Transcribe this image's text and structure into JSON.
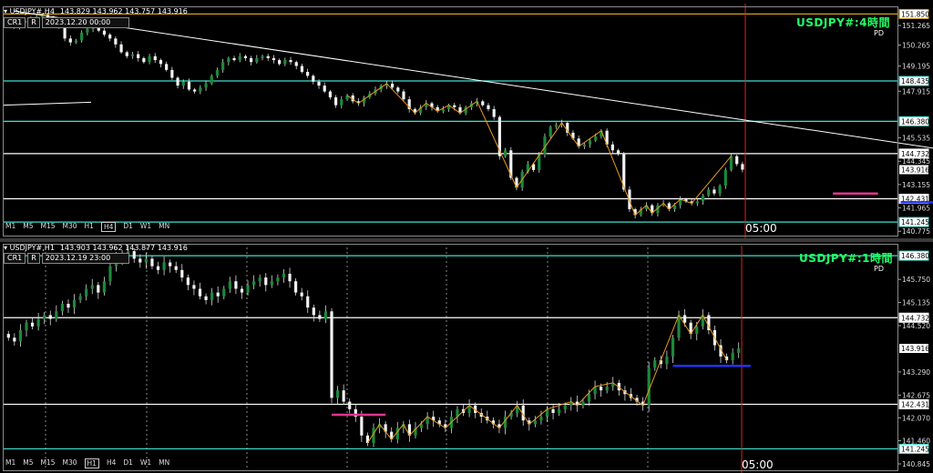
{
  "charts": [
    {
      "header": {
        "symbol": "USDJPY#,H4",
        "ohlc": "143.829 143.962 143.757 143.916"
      },
      "cr_label": "CR1",
      "r_label": "R",
      "cursor_date": "2023.12.20 00:00",
      "title": "USDJPY#:4時間",
      "pd": "PD",
      "timeframes": [
        "M1",
        "M5",
        "M15",
        "M30",
        "H1",
        "H4",
        "D1",
        "W1",
        "MN"
      ],
      "selected_timeframe": "H4",
      "time_label": "05:00"
    },
    {
      "header": {
        "symbol": "USDJPY#,H1",
        "ohlc": "143.903 143.962 143.877 143.916"
      },
      "cr_label": "CR1",
      "r_label": "R",
      "cursor_date": "2023.12.19 23:00",
      "title": "USDJPY#:1時間",
      "pd": "PD",
      "timeframes": [
        "M1",
        "M5",
        "M15",
        "M30",
        "H1",
        "H4",
        "D1",
        "W1",
        "MN"
      ],
      "selected_timeframe": "H1",
      "time_label": "05:00"
    }
  ],
  "chart_data": [
    {
      "type": "candlestick",
      "symbol": "USDJPY#",
      "timeframe": "H4",
      "y_ticks": [
        151.85,
        151.265,
        150.265,
        149.195,
        148.435,
        147.915,
        146.38,
        145.535,
        144.732,
        144.345,
        143.916,
        143.155,
        142.431,
        141.965,
        141.245,
        140.775
      ],
      "ylim": [
        140.6,
        152.1
      ],
      "levels": [
        {
          "price": 151.85,
          "label": "151.850",
          "color": "#d4a017"
        },
        {
          "price": 148.435,
          "label": "148.435",
          "color": "#40e0d0"
        },
        {
          "price": 146.38,
          "label": "146.380",
          "color": "#40e0d0"
        },
        {
          "price": 144.732,
          "label": "144.732",
          "color": "#ffffff"
        },
        {
          "price": 142.431,
          "label": "142.431",
          "color": "#ffffff"
        },
        {
          "price": 141.245,
          "label": "141.245",
          "color": "#40e0d0"
        }
      ],
      "current_price": 143.916,
      "closes": [
        151.3,
        151.2,
        151.4,
        151.5,
        151.6,
        151.7,
        151.8,
        151.6,
        151.5,
        151.2,
        150.6,
        150.4,
        150.5,
        150.9,
        151.1,
        151.3,
        151.0,
        150.8,
        150.6,
        150.3,
        149.9,
        149.7,
        149.8,
        149.6,
        149.4,
        149.7,
        149.5,
        149.3,
        149.0,
        148.6,
        148.2,
        148.4,
        148.0,
        147.9,
        148.1,
        148.3,
        148.7,
        149.0,
        149.4,
        149.6,
        149.5,
        149.7,
        149.6,
        149.4,
        149.6,
        149.7,
        149.6,
        149.5,
        149.3,
        149.5,
        149.4,
        149.2,
        148.9,
        148.7,
        148.4,
        148.2,
        147.9,
        147.6,
        147.2,
        147.5,
        147.7,
        147.4,
        147.3,
        147.6,
        147.8,
        148.0,
        148.2,
        148.3,
        148.1,
        147.9,
        147.5,
        147.0,
        146.8,
        147.1,
        147.3,
        147.1,
        146.9,
        147.0,
        147.2,
        147.1,
        146.8,
        147.1,
        147.3,
        147.4,
        147.2,
        147.0,
        146.6,
        144.6,
        144.9,
        143.5,
        143.0,
        143.8,
        144.2,
        143.9,
        144.7,
        145.6,
        146.1,
        146.2,
        146.3,
        145.8,
        145.5,
        145.1,
        145.2,
        145.4,
        145.6,
        145.9,
        145.2,
        144.9,
        144.7,
        142.9,
        141.9,
        141.6,
        141.9,
        142.1,
        141.7,
        142.1,
        142.2,
        141.9,
        142.1,
        142.4,
        142.3,
        142.2,
        142.3,
        142.6,
        142.9,
        142.7,
        143.1,
        143.9,
        144.6,
        144.2,
        143.916
      ],
      "trendline": {
        "from": [
          1,
          152.0
        ],
        "to": [
          178,
          144.4
        ],
        "color": "#ffffff"
      },
      "markers": [
        {
          "type": "hline",
          "x": [
            146,
            154
          ],
          "price": 142.7,
          "color": "#e0358f"
        },
        {
          "type": "hline",
          "x": [
            158,
            168
          ],
          "price": 142.25,
          "color": "#2233ff"
        }
      ]
    },
    {
      "type": "candlestick",
      "symbol": "USDJPY#",
      "timeframe": "H1",
      "y_ticks": [
        146.38,
        145.75,
        145.135,
        144.732,
        144.52,
        143.916,
        143.29,
        142.675,
        142.431,
        142.07,
        141.46,
        141.245,
        140.845
      ],
      "ylim": [
        140.7,
        146.6
      ],
      "levels": [
        {
          "price": 146.38,
          "label": "146.380",
          "color": "#40e0d0"
        },
        {
          "price": 144.732,
          "label": "144.732",
          "color": "#ffffff"
        },
        {
          "price": 142.431,
          "label": "142.431",
          "color": "#ffffff"
        },
        {
          "price": 141.245,
          "label": "141.245",
          "color": "#40e0d0"
        }
      ],
      "current_price": 143.916,
      "closes": [
        144.2,
        144.1,
        144.4,
        144.6,
        144.5,
        144.7,
        144.8,
        144.7,
        144.9,
        145.1,
        145.0,
        145.2,
        145.3,
        145.5,
        145.6,
        145.4,
        145.7,
        146.1,
        146.4,
        146.3,
        146.5,
        146.3,
        146.2,
        146.3,
        146.1,
        146.0,
        146.2,
        146.1,
        146.0,
        145.8,
        145.6,
        145.5,
        145.3,
        145.2,
        145.4,
        145.3,
        145.5,
        145.7,
        145.5,
        145.4,
        145.6,
        145.7,
        145.8,
        145.6,
        145.7,
        145.8,
        145.9,
        145.7,
        145.4,
        145.3,
        145.0,
        144.8,
        144.7,
        144.9,
        142.6,
        142.8,
        142.5,
        142.3,
        142.1,
        141.6,
        141.4,
        141.8,
        141.9,
        141.7,
        141.5,
        141.8,
        141.9,
        141.6,
        141.8,
        141.9,
        142.1,
        142.0,
        141.9,
        141.8,
        142.1,
        142.3,
        142.2,
        142.4,
        142.2,
        142.1,
        142.0,
        141.9,
        141.8,
        142.1,
        142.2,
        142.4,
        142.0,
        141.9,
        142.0,
        142.1,
        142.3,
        142.2,
        142.3,
        142.4,
        142.5,
        142.4,
        142.5,
        142.7,
        142.9,
        142.8,
        142.9,
        143.0,
        142.8,
        142.7,
        142.6,
        142.5,
        142.4,
        143.4,
        143.6,
        143.5,
        143.7,
        144.2,
        144.8,
        144.6,
        144.3,
        144.5,
        144.8,
        144.4,
        144.0,
        143.7,
        143.6,
        143.8,
        143.916
      ],
      "markers": [
        {
          "type": "hline",
          "x": [
            54,
            63
          ],
          "price": 142.15,
          "color": "#e0358f"
        },
        {
          "type": "hline",
          "x": [
            111,
            124
          ],
          "price": 143.45,
          "color": "#2233ff"
        }
      ]
    }
  ]
}
